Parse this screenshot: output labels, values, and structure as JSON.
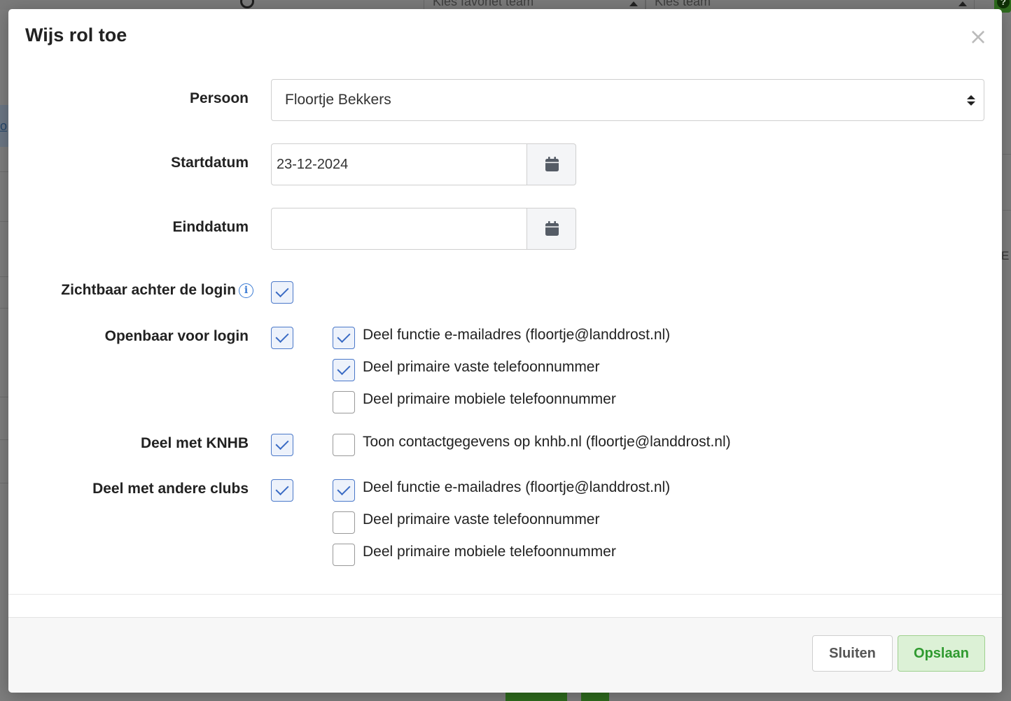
{
  "background": {
    "favorite_team_placeholder": "Kies favoriet team",
    "team_placeholder": "Kies team",
    "help_icon": "question-icon"
  },
  "modal": {
    "title": "Wijs rol toe",
    "close_glyph": "×",
    "person": {
      "label": "Persoon",
      "value": "Floortje Bekkers"
    },
    "start_date": {
      "label": "Startdatum",
      "value": "23-12-2024"
    },
    "end_date": {
      "label": "Einddatum",
      "value": ""
    },
    "visible_behind_login": {
      "label": "Zichtbaar achter de login",
      "info_glyph": "i",
      "checked": true
    },
    "public_for_login": {
      "label": "Openbaar voor login",
      "checked": true,
      "options": [
        {
          "label": "Deel functie e-mailadres (floortje@landdrost.nl)",
          "checked": true
        },
        {
          "label": "Deel primaire vaste telefoonnummer",
          "checked": true
        },
        {
          "label": "Deel primaire mobiele telefoonnummer",
          "checked": false
        }
      ]
    },
    "share_knhb": {
      "label": "Deel met KNHB",
      "checked": true,
      "options": [
        {
          "label": "Toon contactgegevens op knhb.nl (floortje@landdrost.nl)",
          "checked": false
        }
      ]
    },
    "share_clubs": {
      "label": "Deel met andere clubs",
      "checked": true,
      "options": [
        {
          "label": "Deel functie e-mailadres (floortje@landdrost.nl)",
          "checked": true
        },
        {
          "label": "Deel primaire vaste telefoonnummer",
          "checked": false
        },
        {
          "label": "Deel primaire mobiele telefoonnummer",
          "checked": false
        }
      ]
    },
    "footer": {
      "close_label": "Sluiten",
      "save_label": "Opslaan"
    }
  },
  "colors": {
    "accent": "#3a6bc4",
    "save_green": "#2f9a2f",
    "save_bg": "#dcf1d6"
  }
}
